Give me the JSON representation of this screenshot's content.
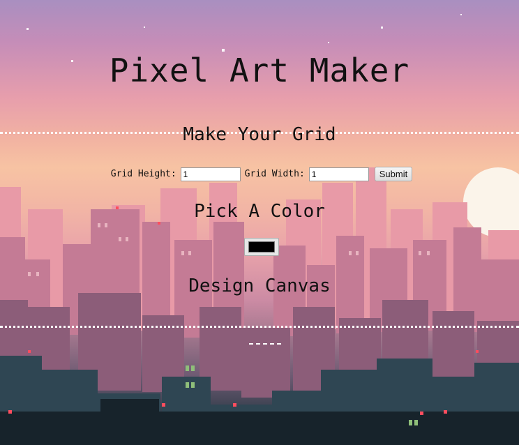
{
  "header": {
    "title": "Pixel Art Maker"
  },
  "grid_section": {
    "heading": "Make Your Grid",
    "height_label": "Grid Height:",
    "height_value": "1",
    "width_label": "Grid Width:",
    "width_value": "1",
    "submit_label": "Submit"
  },
  "color_section": {
    "heading": "Pick A Color",
    "selected_color": "#000000"
  },
  "canvas_section": {
    "heading": "Design Canvas"
  },
  "colors": {
    "text": "#111111",
    "divider": "#ffffff",
    "sky_top": "#a98fc0",
    "sky_horizon": "#f7c3a3"
  }
}
